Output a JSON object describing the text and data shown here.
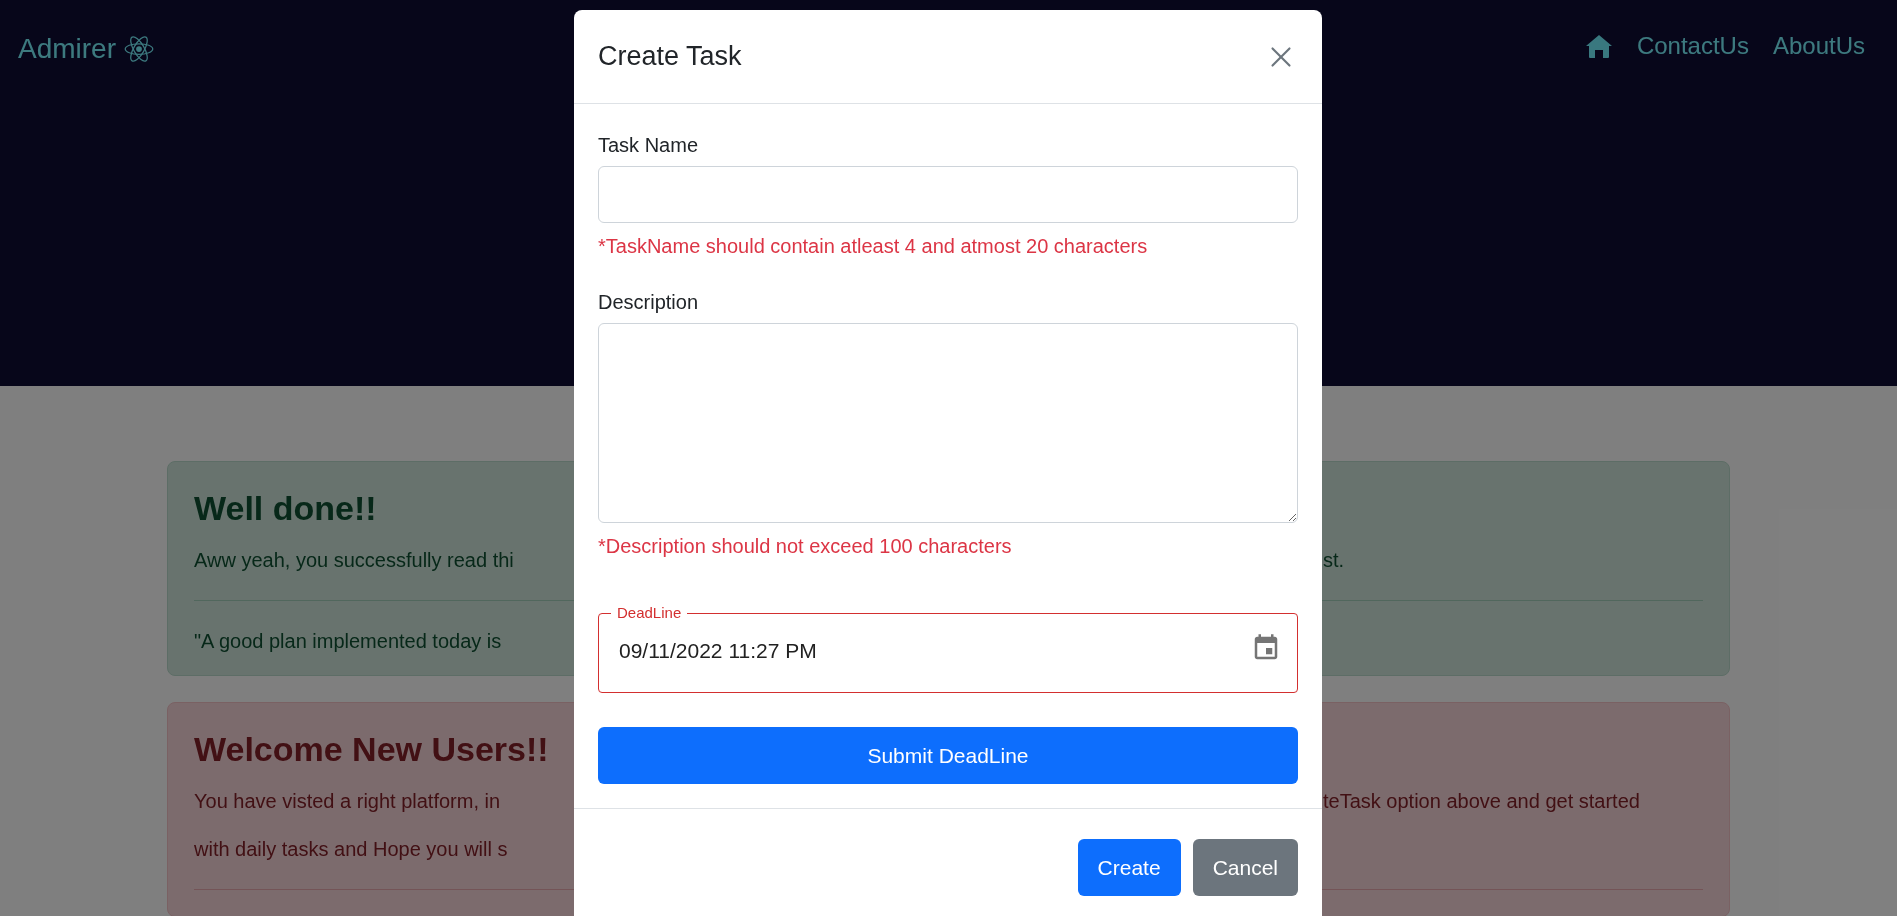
{
  "navbar": {
    "brand": "Admirer",
    "links": [
      {
        "label": "ContactUs"
      },
      {
        "label": "AboutUs"
      }
    ]
  },
  "alerts": [
    {
      "kind": "success",
      "heading": "Well done!!",
      "lines": [
        {
          "left": "Aww yeah, you successfully read thi",
          "right": "st."
        }
      ],
      "footer_lines": [
        {
          "left": "\"A good plan implemented today is"
        }
      ]
    },
    {
      "kind": "danger",
      "heading": "Welcome New Users!!",
      "lines": [
        {
          "left": "You have visted a right platform, in",
          "right": "teTask option above and get started"
        },
        {
          "left": "with daily tasks and Hope you will s"
        }
      ]
    }
  ],
  "modal": {
    "title": "Create Task",
    "fields": [
      {
        "kind": "text",
        "label": "Task Name",
        "error": "*TaskName should contain atleast 4 and atmost 20 characters"
      },
      {
        "kind": "textarea",
        "label": "Description",
        "error": "*Description should not exceed 100 characters"
      },
      {
        "kind": "datetime",
        "label": "DeadLine",
        "value": "09/11/2022 11:27 PM",
        "invalid": true
      }
    ],
    "submit_button": "Submit DeadLine",
    "footer_buttons": [
      {
        "label": "Create",
        "kind": "primary"
      },
      {
        "label": "Cancel",
        "kind": "secondary"
      }
    ]
  }
}
